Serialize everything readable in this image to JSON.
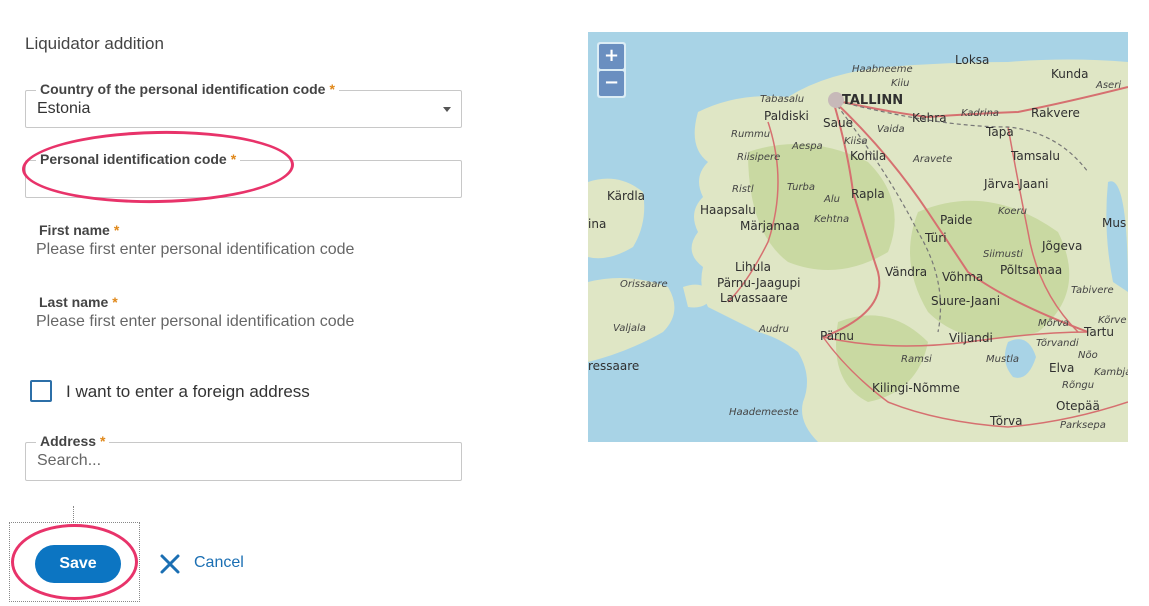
{
  "form": {
    "title": "Liquidator addition",
    "country": {
      "label": "Country of the personal identification code",
      "required_mark": "*",
      "value": "Estonia"
    },
    "personal_code": {
      "label": "Personal identification code",
      "required_mark": "*",
      "value": ""
    },
    "first_name": {
      "label": "First name",
      "required_mark": "*",
      "value": "Please first enter personal identification code"
    },
    "last_name": {
      "label": "Last name",
      "required_mark": "*",
      "value": "Please first enter personal identification code"
    },
    "foreign_address": {
      "label": "I want to enter a foreign address",
      "checked": false
    },
    "address": {
      "label": "Address",
      "required_mark": "*",
      "placeholder": "Search..."
    }
  },
  "actions": {
    "save_label": "Save",
    "cancel_label": "Cancel"
  },
  "map": {
    "zoom_in": "+",
    "zoom_out": "−",
    "labels": [
      "Haabneeme",
      "Loksa",
      "Kunda",
      "Aseri",
      "Kiiu",
      "Tabasalu",
      "TALLINN",
      "Paldiski",
      "Saue",
      "Kehra",
      "Kadrina",
      "Rakvere",
      "Rummu",
      "Vaida",
      "Tapa",
      "Aespa",
      "Kiisa",
      "Riisipere",
      "Kohila",
      "Aravete",
      "Tamsalu",
      "Ristl",
      "Turba",
      "Järva-Jaani",
      "Kärdla",
      "Haapsalu",
      "Alu",
      "Rapla",
      "Kehtna",
      "Koeru",
      "Märjamaa",
      "Paide",
      "Türi",
      "Siimusti",
      "Jõgeva",
      "Lihula",
      "Vändra",
      "Võhma",
      "Põltsamaa",
      "Orissaare",
      "Pärnu-Jaagupi",
      "Tabivere",
      "Lavassaare",
      "Suure-Jaani",
      "Valjala",
      "Audru",
      "Pärnu",
      "Viljandi",
      "Mõrva",
      "Tartu",
      "Tõrvandi",
      "Nõo",
      "Mustla",
      "Elva",
      "Ramsi",
      "Kambja",
      "Rõngu",
      "Kilingi-Nõmme",
      "Haademeeste",
      "Tõrva",
      "Otepää",
      "Parksepa",
      "ressaare",
      "ina",
      "Mus",
      "Kõrve"
    ],
    "colors": {
      "water": "#a8d3e6",
      "land": "#dfe6c5",
      "forest": "#c9d9a2",
      "road": "#d67070"
    }
  },
  "annotations": {
    "highlight_color": "#e8336a"
  }
}
